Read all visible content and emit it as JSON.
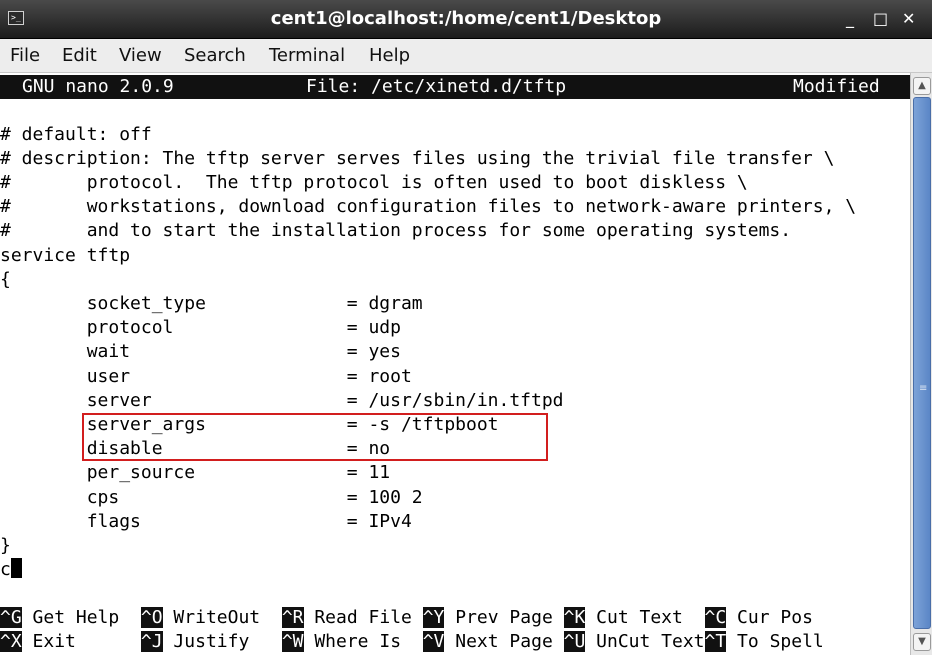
{
  "window": {
    "title": "cent1@localhost:/home/cent1/Desktop",
    "icon": "terminal-icon",
    "minimize": "_",
    "maximize": "□",
    "close": "✕"
  },
  "menu": [
    "File",
    "Edit",
    "View",
    "Search",
    "Terminal",
    "Help"
  ],
  "nano": {
    "version": "GNU nano 2.0.9",
    "file": "File: /etc/xinetd.d/tftp",
    "status": "Modified"
  },
  "lines": [
    "",
    "# default: off",
    "# description: The tftp server serves files using the trivial file transfer \\",
    "#       protocol.  The tftp protocol is often used to boot diskless \\",
    "#       workstations, download configuration files to network-aware printers, \\",
    "#       and to start the installation process for some operating systems.",
    "service tftp",
    "{",
    "        socket_type             = dgram",
    "        protocol                = udp",
    "        wait                    = yes",
    "        user                    = root",
    "        server                  = /usr/sbin/in.tftpd",
    "        server_args             = -s /tftpboot",
    "        disable                 = no",
    "        per_source              = 11",
    "        cps                     = 100 2",
    "        flags                   = IPv4",
    "}"
  ],
  "cursor_line": "c",
  "shortcuts": {
    "row1": [
      {
        "key": "^G",
        "label": " Get Help  "
      },
      {
        "key": "^O",
        "label": " WriteOut  "
      },
      {
        "key": "^R",
        "label": " Read File "
      },
      {
        "key": "^Y",
        "label": " Prev Page "
      },
      {
        "key": "^K",
        "label": " Cut Text  "
      },
      {
        "key": "^C",
        "label": " Cur Pos"
      }
    ],
    "row2": [
      {
        "key": "^X",
        "label": " Exit      "
      },
      {
        "key": "^J",
        "label": " Justify   "
      },
      {
        "key": "^W",
        "label": " Where Is  "
      },
      {
        "key": "^V",
        "label": " Next Page "
      },
      {
        "key": "^U",
        "label": " UnCut Text"
      },
      {
        "key": "^T",
        "label": " To Spell"
      }
    ]
  },
  "colors": {
    "highlight_box": "#d21e1e",
    "scrollbar_thumb": "#5b86c6"
  }
}
